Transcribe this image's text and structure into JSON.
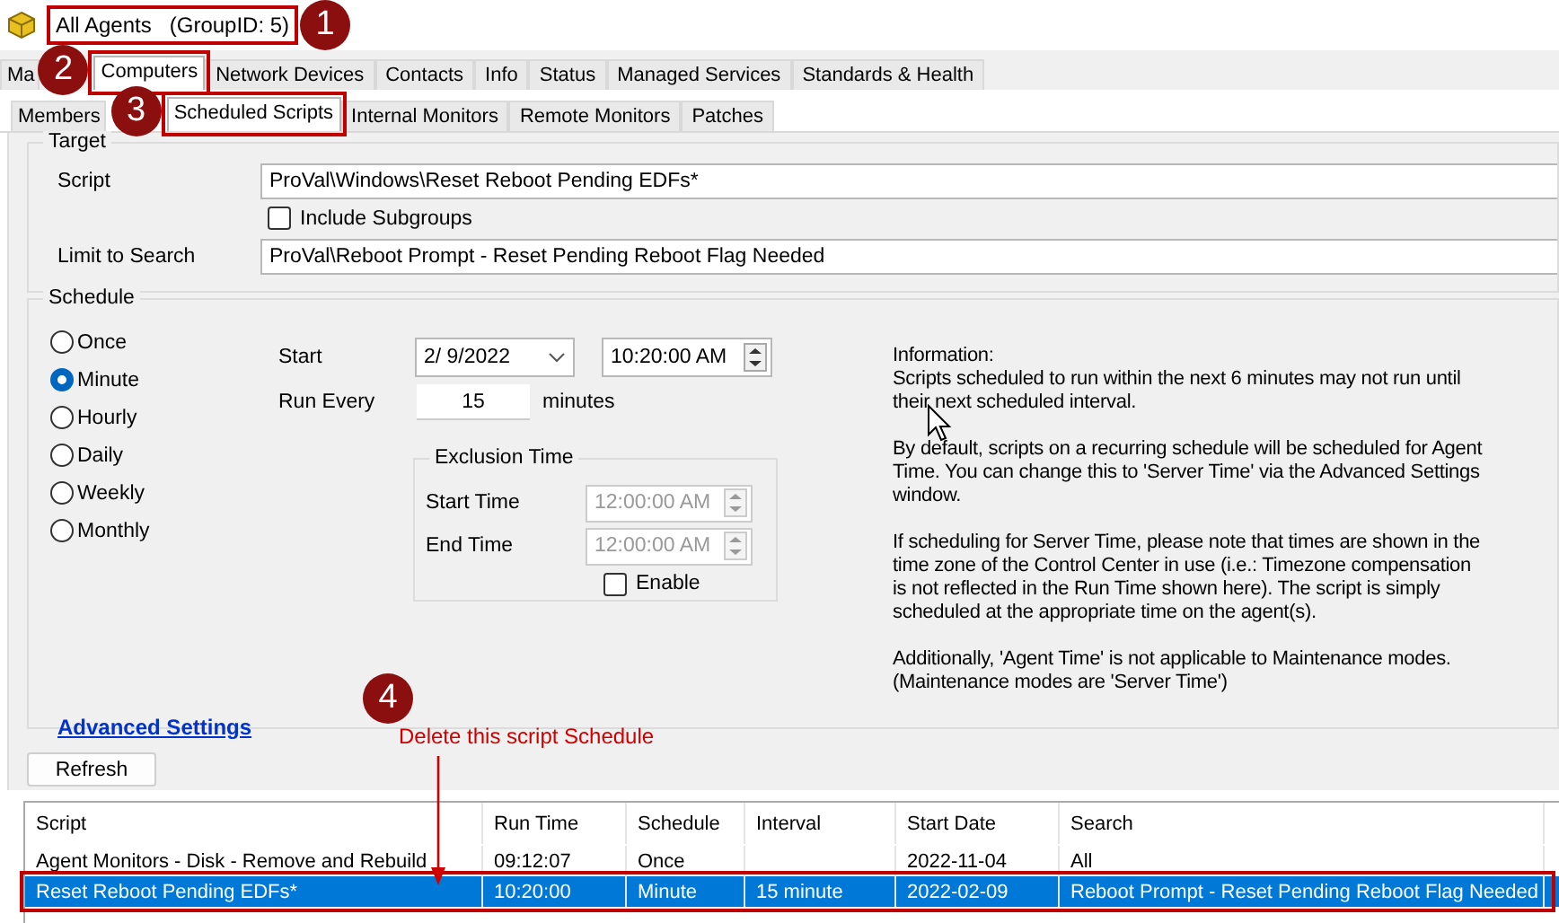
{
  "window": {
    "title": "All Agents   (GroupID: 5)"
  },
  "tabs": [
    {
      "label": "Ma",
      "selected": false
    },
    {
      "label": "Computers",
      "selected": true
    },
    {
      "label": "Network Devices",
      "selected": false
    },
    {
      "label": "Contacts",
      "selected": false
    },
    {
      "label": "Info",
      "selected": false
    },
    {
      "label": "Status",
      "selected": false
    },
    {
      "label": "Managed Services",
      "selected": false
    },
    {
      "label": "Standards & Health",
      "selected": false
    }
  ],
  "subtabs": [
    {
      "label": "Members",
      "selected": false
    },
    {
      "label": "Scheduled Scripts",
      "selected": true
    },
    {
      "label": "Internal Monitors",
      "selected": false
    },
    {
      "label": "Remote Monitors",
      "selected": false
    },
    {
      "label": "Patches",
      "selected": false
    }
  ],
  "target": {
    "title": "Target",
    "script_label": "Script",
    "script": "ProVal\\Windows\\Reset Reboot Pending EDFs*",
    "include_subgroups": {
      "label": "Include Subgroups",
      "checked": false
    },
    "search_label": "Limit to Search",
    "search": "ProVal\\Reboot Prompt - Reset Pending Reboot Flag Needed"
  },
  "schedule": {
    "title": "Schedule",
    "frequencies": [
      {
        "label": "Once",
        "selected": false
      },
      {
        "label": "Minute",
        "selected": true
      },
      {
        "label": "Hourly",
        "selected": false
      },
      {
        "label": "Daily",
        "selected": false
      },
      {
        "label": "Weekly",
        "selected": false
      },
      {
        "label": "Monthly",
        "selected": false
      }
    ],
    "start_label": "Start",
    "start_date": "2/ 9/2022",
    "start_time": "10:20:00 AM",
    "run_every_label": "Run Every",
    "run_every": "15",
    "run_every_unit": "minutes",
    "exclusion": {
      "title": "Exclusion Time",
      "disabled": true,
      "start_label": "Start Time",
      "start": "12:00:00 AM",
      "end_label": "End Time",
      "end": "12:00:00 AM",
      "enable": {
        "label": "Enable",
        "checked": false
      }
    },
    "info": [
      "Information:",
      "Scripts scheduled to run within the next 6 minutes may not run until their next scheduled interval.",
      "By default, scripts on a recurring schedule will be scheduled for Agent Time. You can change this to 'Server Time' via the Advanced Settings window.",
      "If scheduling for Server Time, please note that times are shown in the time zone of the Control Center in use (i.e.: Timezone compensation is not reflected in the Run Time shown here). The script is simply scheduled at the appropriate time on the agent(s).",
      "Additionally, 'Agent Time' is not applicable to Maintenance modes. (Maintenance modes are 'Server Time')"
    ],
    "advanced_link": "Advanced Settings"
  },
  "refresh_button": "Refresh",
  "table": {
    "columns": [
      "Script",
      "Run Time",
      "Schedule",
      "Interval",
      "Start Date",
      "Search"
    ],
    "rows": [
      {
        "selected": false,
        "cells": [
          "Agent Monitors - Disk - Remove and Rebuild",
          "09:12:07",
          "Once",
          "",
          "2022-11-04",
          "All"
        ]
      },
      {
        "selected": true,
        "cells": [
          "Reset Reboot Pending EDFs*",
          "10:20:00",
          "Minute",
          "15 minute",
          "2022-02-09",
          "Reboot Prompt - Reset Pending Reboot Flag Needed"
        ]
      }
    ]
  },
  "annotations": [
    "1",
    "2",
    "3",
    "4"
  ],
  "callout": "Delete this script Schedule"
}
